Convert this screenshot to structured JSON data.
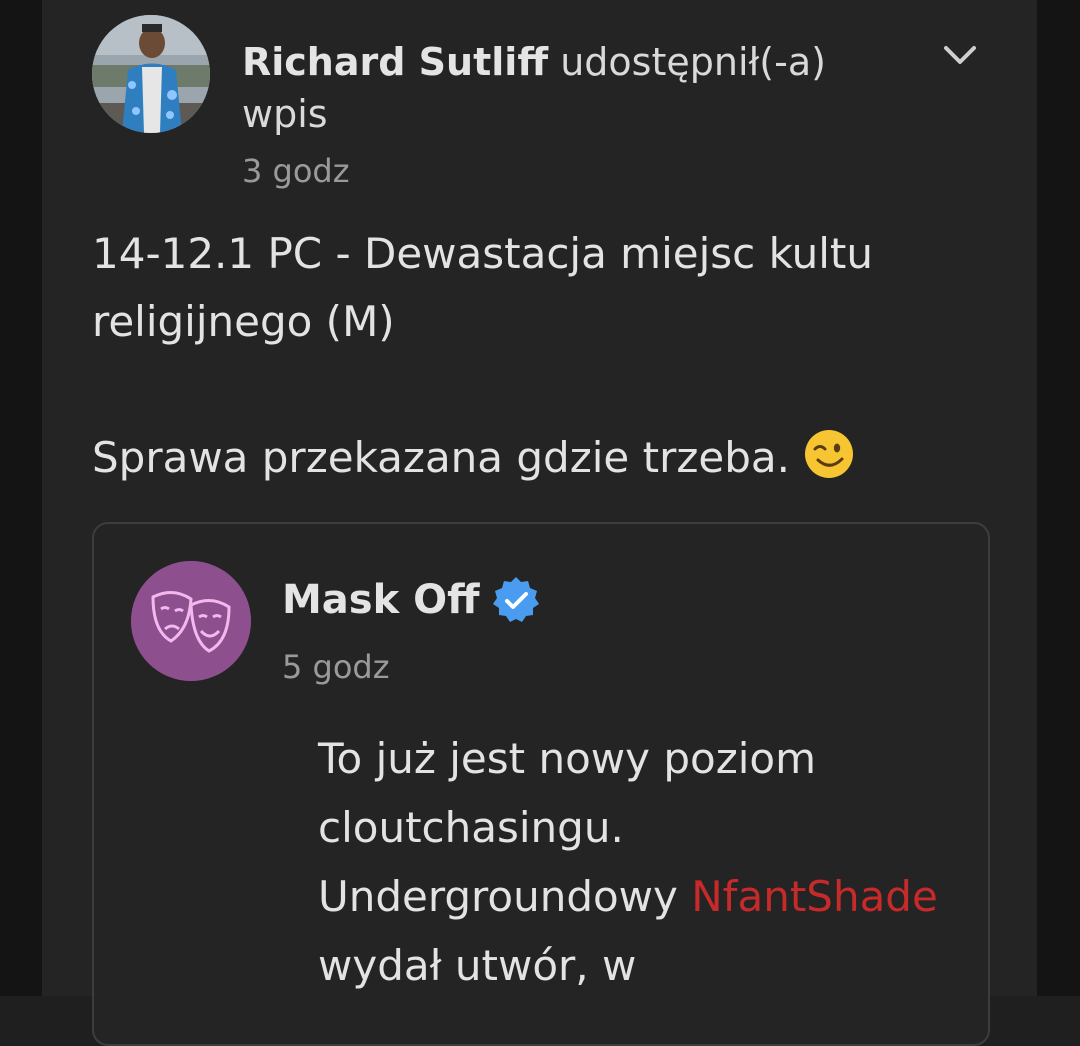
{
  "post": {
    "author": "Richard Sutliff",
    "action": "udostępnił(-a)",
    "action_object": "wpis",
    "time": "3 godz",
    "text_line1": "14-12.1 PC - Dewastacja miejsc kultu religijnego (M)",
    "text_line2": "Sprawa przekazana gdzie trzeba.",
    "emoji": "winking-face"
  },
  "shared": {
    "author": "Mask Off",
    "verified": true,
    "time": "5 godz",
    "text_part1": "To już jest nowy poziom cloutchasingu. Undergroundowy",
    "mention": "NfantShade",
    "text_part2": "wydał utwór, w"
  },
  "colors": {
    "background": "#242424",
    "mention": "#c62a2a",
    "verified": "#4a9cf0",
    "mask_avatar": "#8e4f8e"
  },
  "icons": {
    "menu": "chevron-down-icon",
    "verified": "verified-badge-icon"
  }
}
